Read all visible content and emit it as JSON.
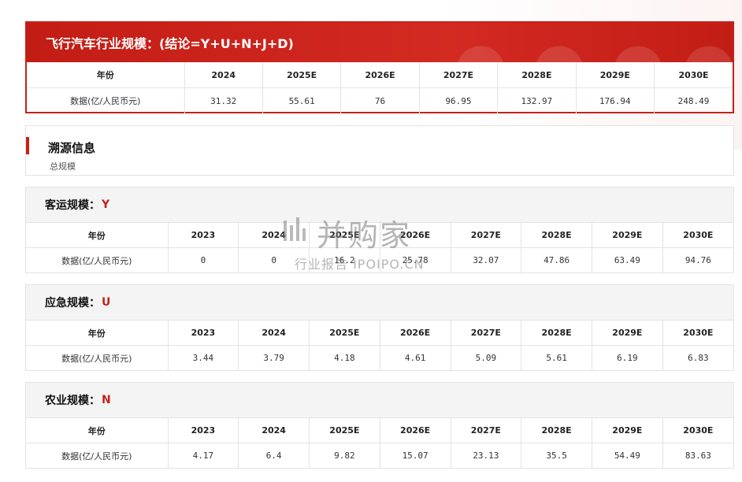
{
  "summary": {
    "title": "飞行汽车行业规模：(结论=Y+U+N+J+D)",
    "header_label": "年份",
    "years": [
      "2024",
      "2025E",
      "2026E",
      "2027E",
      "2028E",
      "2029E",
      "2030E"
    ],
    "row_label": "数据(亿/人民币元)",
    "values": [
      "31.32",
      "55.61",
      "76",
      "96.95",
      "132.97",
      "176.94",
      "248.49"
    ]
  },
  "trace": {
    "title": "溯源信息",
    "subtitle": "总规模"
  },
  "sections": [
    {
      "title": "客运规模：",
      "code": "Y",
      "header_label": "年份",
      "years": [
        "2023",
        "2024",
        "2025E",
        "2026E",
        "2027E",
        "2028E",
        "2029E",
        "2030E"
      ],
      "row_label": "数据(亿/人民币元)",
      "values": [
        "0",
        "0",
        "16.2",
        "25.78",
        "32.07",
        "47.86",
        "63.49",
        "94.76"
      ]
    },
    {
      "title": "应急规模：",
      "code": "U",
      "header_label": "年份",
      "years": [
        "2023",
        "2024",
        "2025E",
        "2026E",
        "2027E",
        "2028E",
        "2029E",
        "2030E"
      ],
      "row_label": "数据(亿/人民币元)",
      "values": [
        "3.44",
        "3.79",
        "4.18",
        "4.61",
        "5.09",
        "5.61",
        "6.19",
        "6.83"
      ]
    },
    {
      "title": "农业规模：",
      "code": "N",
      "header_label": "年份",
      "years": [
        "2023",
        "2024",
        "2025E",
        "2026E",
        "2027E",
        "2028E",
        "2029E",
        "2030E"
      ],
      "row_label": "数据(亿/人民币元)",
      "values": [
        "4.17",
        "6.4",
        "9.82",
        "15.07",
        "23.13",
        "35.5",
        "54.49",
        "83.63"
      ]
    }
  ],
  "watermark": {
    "logo_text": "并购家",
    "sub_text": "行业报告 IPOIPO.CN"
  },
  "colors": {
    "accent": "#c4211a",
    "section_header_bg": "#f4f4f4",
    "border": "#e3e3e3"
  }
}
